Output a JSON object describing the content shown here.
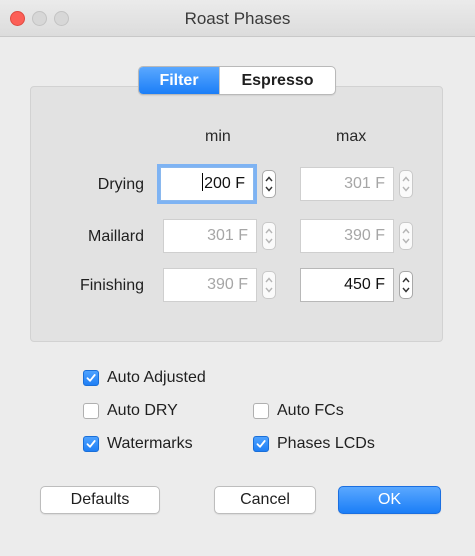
{
  "window": {
    "title": "Roast Phases"
  },
  "tabs": [
    {
      "label": "Filter",
      "selected": true
    },
    {
      "label": "Espresso",
      "selected": false
    }
  ],
  "columns": {
    "min": "min",
    "max": "max"
  },
  "phases": [
    {
      "label": "Drying",
      "min": "200 F",
      "max": "301 F"
    },
    {
      "label": "Maillard",
      "min": "301 F",
      "max": "390 F"
    },
    {
      "label": "Finishing",
      "min": "390 F",
      "max": "450 F"
    }
  ],
  "checkboxes": {
    "auto_adjusted": {
      "label": "Auto Adjusted",
      "checked": true
    },
    "auto_dry": {
      "label": "Auto DRY",
      "checked": false
    },
    "auto_fcs": {
      "label": "Auto FCs",
      "checked": false
    },
    "watermarks": {
      "label": "Watermarks",
      "checked": true
    },
    "phases_lcds": {
      "label": "Phases LCDs",
      "checked": true
    }
  },
  "buttons": {
    "defaults": "Defaults",
    "cancel": "Cancel",
    "ok": "OK"
  },
  "colors": {
    "accent": "#1b7ef7",
    "close": "#fc5f57",
    "background": "#ececec"
  }
}
